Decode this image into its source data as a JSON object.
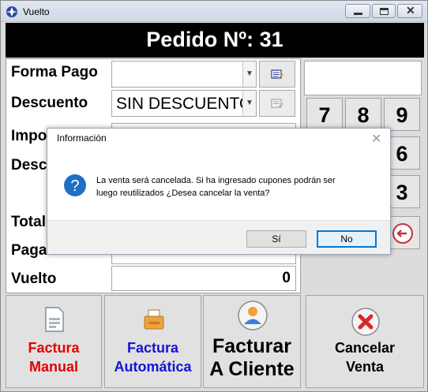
{
  "window": {
    "title": "Vuelto"
  },
  "header": {
    "title": "Pedido Nº: 31"
  },
  "form": {
    "forma_pago_label": "Forma Pago",
    "forma_pago_value": "",
    "descuento_label": "Descuento",
    "descuento_value": "SIN DESCUENTO",
    "importe_label": "Impo",
    "descuento_monto_label": "Desc",
    "total_label": "Total",
    "paga_label": "Paga",
    "vuelto_label": "Vuelto",
    "vuelto_value": "0"
  },
  "keypad": {
    "keys": [
      "7",
      "8",
      "9",
      "6",
      "3"
    ]
  },
  "buttons": {
    "factura_manual": [
      "Factura",
      "Manual"
    ],
    "factura_automatica": [
      "Factura",
      "Automática"
    ],
    "facturar_cliente": [
      "Facturar",
      "A Cliente"
    ],
    "cancelar_venta": [
      "Cancelar",
      "Venta"
    ]
  },
  "dialog": {
    "title": "Información",
    "message_line1": "La venta será cancelada. Si ha ingresado cupones podrán ser",
    "message_line2": "luego reutilizados ¿Desea cancelar la venta?",
    "yes_label": "Sí",
    "no_label": "No"
  },
  "colors": {
    "factura_manual": "#e30000",
    "factura_automatica": "#1414d4",
    "header_bg": "#000000",
    "dialog_focus": "#0078d7"
  }
}
